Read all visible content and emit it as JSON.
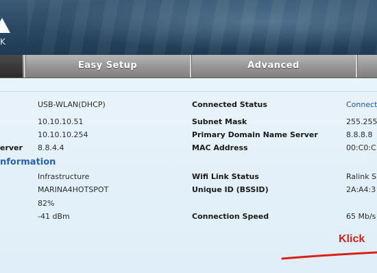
{
  "header": {
    "logo_letter": "K"
  },
  "nav": {
    "tabs": [
      {
        "label": "Easy Setup"
      },
      {
        "label": "Advanced"
      },
      {
        "label": ""
      }
    ]
  },
  "status": {
    "left": [
      {
        "label": "",
        "value": "USB-WLAN(DHCP)"
      },
      {
        "label": "",
        "value": "10.10.10.51"
      },
      {
        "label": "",
        "value": "10.10.10.254"
      },
      {
        "label": "erver",
        "value": "8.8.4.4"
      }
    ],
    "right": [
      {
        "label": "Connected Status",
        "value": "Connect"
      },
      {
        "label": "Subnet Mask",
        "value": "255.255"
      },
      {
        "label": "Primary Domain Name Server",
        "value": "8.8.8.8"
      },
      {
        "label": "MAC Address",
        "value": "00:C0:C"
      }
    ]
  },
  "wireless": {
    "section_title": "nformation",
    "left": [
      {
        "value": "Infrastructure"
      },
      {
        "value": "MARINA4HOTSPOT"
      },
      {
        "value": "82%"
      },
      {
        "value": "-41 dBm"
      }
    ],
    "right": [
      {
        "label": "Wifi Link Status",
        "value": "Ralink S"
      },
      {
        "label": "Unique ID (BSSID)",
        "value": "2A:A4:3"
      },
      {
        "label": "",
        "value": ""
      },
      {
        "label": "Connection Speed",
        "value": "65 Mb/s"
      }
    ]
  },
  "annotation": {
    "text": "Klick",
    "color": "#d8201a"
  }
}
